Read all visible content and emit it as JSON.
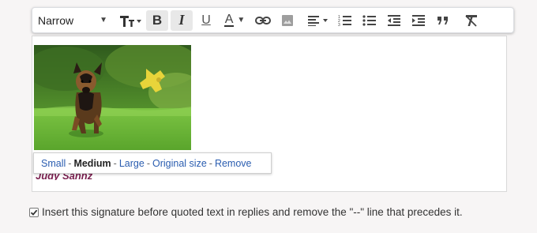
{
  "toolbar": {
    "font": {
      "label": "Narrow",
      "icon": "chevron-down-icon"
    },
    "buttons": [
      {
        "name": "font-size-button",
        "icon": "text-size-icon"
      },
      {
        "name": "bold-button",
        "icon": "bold-icon",
        "glyph": "B",
        "active": true
      },
      {
        "name": "italic-button",
        "icon": "italic-icon",
        "glyph": "I",
        "active": true
      },
      {
        "name": "underline-button",
        "icon": "underline-icon",
        "glyph": "U"
      },
      {
        "name": "text-color-button",
        "icon": "text-color-icon",
        "glyph": "A"
      },
      {
        "name": "insert-link-button",
        "icon": "link-icon"
      },
      {
        "name": "insert-image-button",
        "icon": "image-icon"
      },
      {
        "name": "align-button",
        "icon": "align-left-icon"
      },
      {
        "name": "numbered-list-button",
        "icon": "numbered-list-icon"
      },
      {
        "name": "bulleted-list-button",
        "icon": "bulleted-list-icon"
      },
      {
        "name": "indent-less-button",
        "icon": "indent-less-icon"
      },
      {
        "name": "indent-more-button",
        "icon": "indent-more-icon"
      },
      {
        "name": "quote-button",
        "icon": "quote-icon"
      },
      {
        "name": "remove-formatting-button",
        "icon": "remove-formatting-icon"
      }
    ]
  },
  "image_size_menu": {
    "small": "Small",
    "medium": "Medium",
    "large": "Large",
    "original": "Original size",
    "remove": "Remove",
    "separator": "-"
  },
  "signature": {
    "name": "Judy Sannz"
  },
  "option": {
    "checked": true,
    "label": "Insert this signature before quoted text in replies and remove the \"--\" line that precedes it."
  },
  "colors": {
    "link": "#2a5db0",
    "signature": "#7a1f4f"
  }
}
